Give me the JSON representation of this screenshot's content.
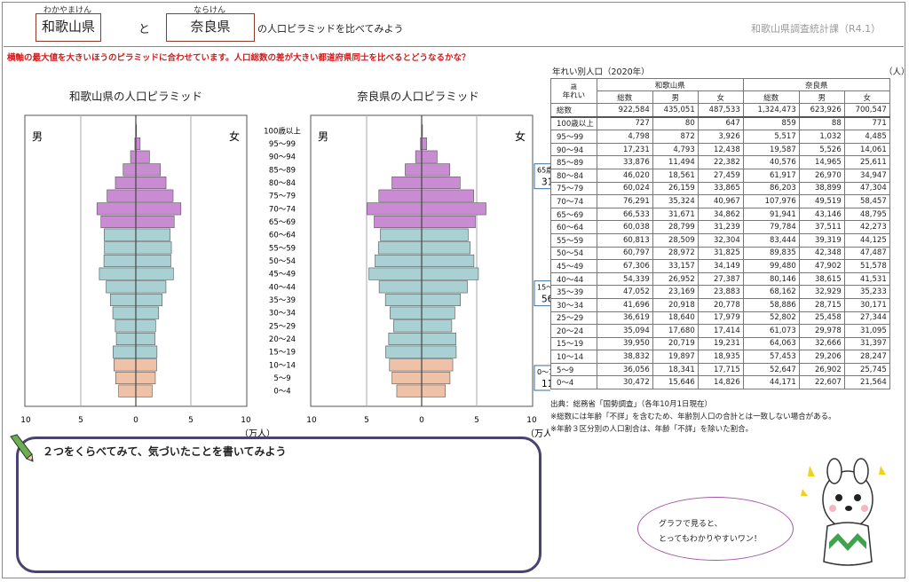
{
  "header": {
    "ruby_wakayama": "わかやまけん",
    "ruby_nara": "ならけん",
    "pref1": "和歌山県",
    "connector": "と",
    "pref2": "奈良県",
    "title_suffix": "の人口ピラミッドを比べてみよう",
    "publisher": "和歌山県調査統計課（R4.1）"
  },
  "notice": "横軸の最大値を大きいほうのピラミッドに合わせています。人口総数の差が大きい都道府県同士を比べるとどうなるかな？",
  "pyramid_left": {
    "title": "和歌山県の人口ピラミッド",
    "male": "男",
    "female": "女",
    "labels": [
      {
        "name": "65歳以上",
        "value": "33.4%"
      },
      {
        "name": "15～64歳",
        "value": "55.1%"
      },
      {
        "name": "0～14歳",
        "value": "11.5%"
      }
    ]
  },
  "pyramid_right": {
    "title": "奈良県の人口ピラミッド",
    "male": "男",
    "female": "女",
    "labels": [
      {
        "name": "65歳以上",
        "value": "31.7%"
      },
      {
        "name": "15～64歳",
        "value": "56.5%"
      },
      {
        "name": "0～14歳",
        "value": "11.8%"
      }
    ]
  },
  "axis": {
    "ticks": [
      "10",
      "5",
      "0",
      "5",
      "10"
    ],
    "unit": "（万人）"
  },
  "chart_data": [
    {
      "type": "bar",
      "title": "和歌山県の人口ピラミッド",
      "orientation": "horizontal-pyramid",
      "categories": [
        "100歳以上",
        "95～99",
        "90～94",
        "85～89",
        "80～84",
        "75～79",
        "70～74",
        "65～69",
        "60～64",
        "55～59",
        "50～54",
        "45～49",
        "40～44",
        "35～39",
        "30～34",
        "25～29",
        "20～24",
        "15～19",
        "10～14",
        "5～9",
        "0～4"
      ],
      "xlabel": "（万人）",
      "xlim": [
        -10,
        10
      ],
      "series": [
        {
          "name": "男",
          "values": [
            0.008,
            0.0872,
            0.4793,
            1.1494,
            1.8561,
            2.6159,
            3.5324,
            3.1671,
            2.8799,
            2.8509,
            2.8972,
            3.3157,
            2.6952,
            2.3169,
            2.0918,
            1.864,
            1.768,
            2.0719,
            1.9897,
            1.8341,
            1.5646
          ]
        },
        {
          "name": "女",
          "values": [
            0.0647,
            0.3926,
            1.2438,
            2.2382,
            2.7459,
            3.3865,
            4.0967,
            3.4862,
            3.1239,
            3.2304,
            3.1825,
            3.4149,
            2.7387,
            2.3883,
            2.0778,
            1.7979,
            1.7414,
            1.9231,
            1.8935,
            1.7715,
            1.4826
          ]
        }
      ]
    },
    {
      "type": "bar",
      "title": "奈良県の人口ピラミッド",
      "orientation": "horizontal-pyramid",
      "categories": [
        "100歳以上",
        "95～99",
        "90～94",
        "85～89",
        "80～84",
        "75～79",
        "70～74",
        "65～69",
        "60～64",
        "55～59",
        "50～54",
        "45～49",
        "40～44",
        "35～39",
        "30～34",
        "25～29",
        "20～24",
        "15～19",
        "10～14",
        "5～9",
        "0～4"
      ],
      "xlabel": "（万人）",
      "xlim": [
        -10,
        10
      ],
      "series": [
        {
          "name": "男",
          "values": [
            0.0088,
            0.1032,
            0.5526,
            1.4965,
            2.697,
            3.8899,
            4.9519,
            4.3146,
            3.7511,
            3.9319,
            4.2348,
            4.7902,
            3.8615,
            3.2929,
            2.8715,
            2.5458,
            2.9978,
            3.2666,
            2.9206,
            2.6902,
            2.2607
          ]
        },
        {
          "name": "女",
          "values": [
            0.0771,
            0.4485,
            1.4061,
            2.5611,
            3.4947,
            4.7304,
            5.8457,
            4.8795,
            4.2273,
            4.4125,
            4.7487,
            5.1578,
            4.1531,
            3.5233,
            3.0171,
            2.7344,
            3.1095,
            3.1397,
            2.8247,
            2.5745,
            2.1564
          ]
        }
      ]
    }
  ],
  "table": {
    "caption": "年れい別人口（2020年）",
    "unit": "（人）",
    "sai": "歳",
    "age_header": "年れい",
    "pref1": "和歌山県",
    "pref2": "奈良県",
    "sub": [
      "総数",
      "男",
      "女",
      "総数",
      "男",
      "女"
    ],
    "rows": [
      {
        "label": "総数",
        "v": [
          "922,584",
          "435,051",
          "487,533",
          "1,324,473",
          "623,926",
          "700,547"
        ]
      },
      {
        "label": "100歳以上",
        "v": [
          "727",
          "80",
          "647",
          "859",
          "88",
          "771"
        ]
      },
      {
        "label": "95～99",
        "v": [
          "4,798",
          "872",
          "3,926",
          "5,517",
          "1,032",
          "4,485"
        ]
      },
      {
        "label": "90～94",
        "v": [
          "17,231",
          "4,793",
          "12,438",
          "19,587",
          "5,526",
          "14,061"
        ]
      },
      {
        "label": "85～89",
        "v": [
          "33,876",
          "11,494",
          "22,382",
          "40,576",
          "14,965",
          "25,611"
        ]
      },
      {
        "label": "80～84",
        "v": [
          "46,020",
          "18,561",
          "27,459",
          "61,917",
          "26,970",
          "34,947"
        ]
      },
      {
        "label": "75～79",
        "v": [
          "60,024",
          "26,159",
          "33,865",
          "86,203",
          "38,899",
          "47,304"
        ]
      },
      {
        "label": "70～74",
        "v": [
          "76,291",
          "35,324",
          "40,967",
          "107,976",
          "49,519",
          "58,457"
        ]
      },
      {
        "label": "65～69",
        "v": [
          "66,533",
          "31,671",
          "34,862",
          "91,941",
          "43,146",
          "48,795"
        ]
      },
      {
        "label": "60～64",
        "v": [
          "60,038",
          "28,799",
          "31,239",
          "79,784",
          "37,511",
          "42,273"
        ]
      },
      {
        "label": "55～59",
        "v": [
          "60,813",
          "28,509",
          "32,304",
          "83,444",
          "39,319",
          "44,125"
        ]
      },
      {
        "label": "50～54",
        "v": [
          "60,797",
          "28,972",
          "31,825",
          "89,835",
          "42,348",
          "47,487"
        ]
      },
      {
        "label": "45～49",
        "v": [
          "67,306",
          "33,157",
          "34,149",
          "99,480",
          "47,902",
          "51,578"
        ]
      },
      {
        "label": "40～44",
        "v": [
          "54,339",
          "26,952",
          "27,387",
          "80,146",
          "38,615",
          "41,531"
        ]
      },
      {
        "label": "35～39",
        "v": [
          "47,052",
          "23,169",
          "23,883",
          "68,162",
          "32,929",
          "35,233"
        ]
      },
      {
        "label": "30～34",
        "v": [
          "41,696",
          "20,918",
          "20,778",
          "58,886",
          "28,715",
          "30,171"
        ]
      },
      {
        "label": "25～29",
        "v": [
          "36,619",
          "18,640",
          "17,979",
          "52,802",
          "25,458",
          "27,344"
        ]
      },
      {
        "label": "20～24",
        "v": [
          "35,094",
          "17,680",
          "17,414",
          "61,073",
          "29,978",
          "31,095"
        ]
      },
      {
        "label": "15～19",
        "v": [
          "39,950",
          "20,719",
          "19,231",
          "64,063",
          "32,666",
          "31,397"
        ]
      },
      {
        "label": "10～14",
        "v": [
          "38,832",
          "19,897",
          "18,935",
          "57,453",
          "29,206",
          "28,247"
        ]
      },
      {
        "label": "5～9",
        "v": [
          "36,056",
          "18,341",
          "17,715",
          "52,647",
          "26,902",
          "25,745"
        ]
      },
      {
        "label": "0～4",
        "v": [
          "30,472",
          "15,646",
          "14,826",
          "44,171",
          "22,607",
          "21,564"
        ]
      }
    ],
    "source": "出典：総務省「国勢調査」（各年10月1日現在）",
    "note1": "※総数には年齢「不詳」を含むため、年齢別人口の合計とは一致しない場合がある。",
    "note2": "※年齢３区分別の人口割合は、年齢「不詳」を除いた割合。"
  },
  "worksheet": {
    "prompt": "２つをくらべてみて、気づいたことを書いてみよう"
  },
  "mascot": {
    "line1": "グラフで見ると、",
    "line2": "とってもわかりやすいワン！"
  },
  "colors": {
    "elderly": "#c98bd2",
    "working": "#a9d0d3",
    "young": "#efc2a8",
    "title_border": "#8b3a2c",
    "notice": "#d21b1b",
    "notebox": "#4a4270"
  }
}
